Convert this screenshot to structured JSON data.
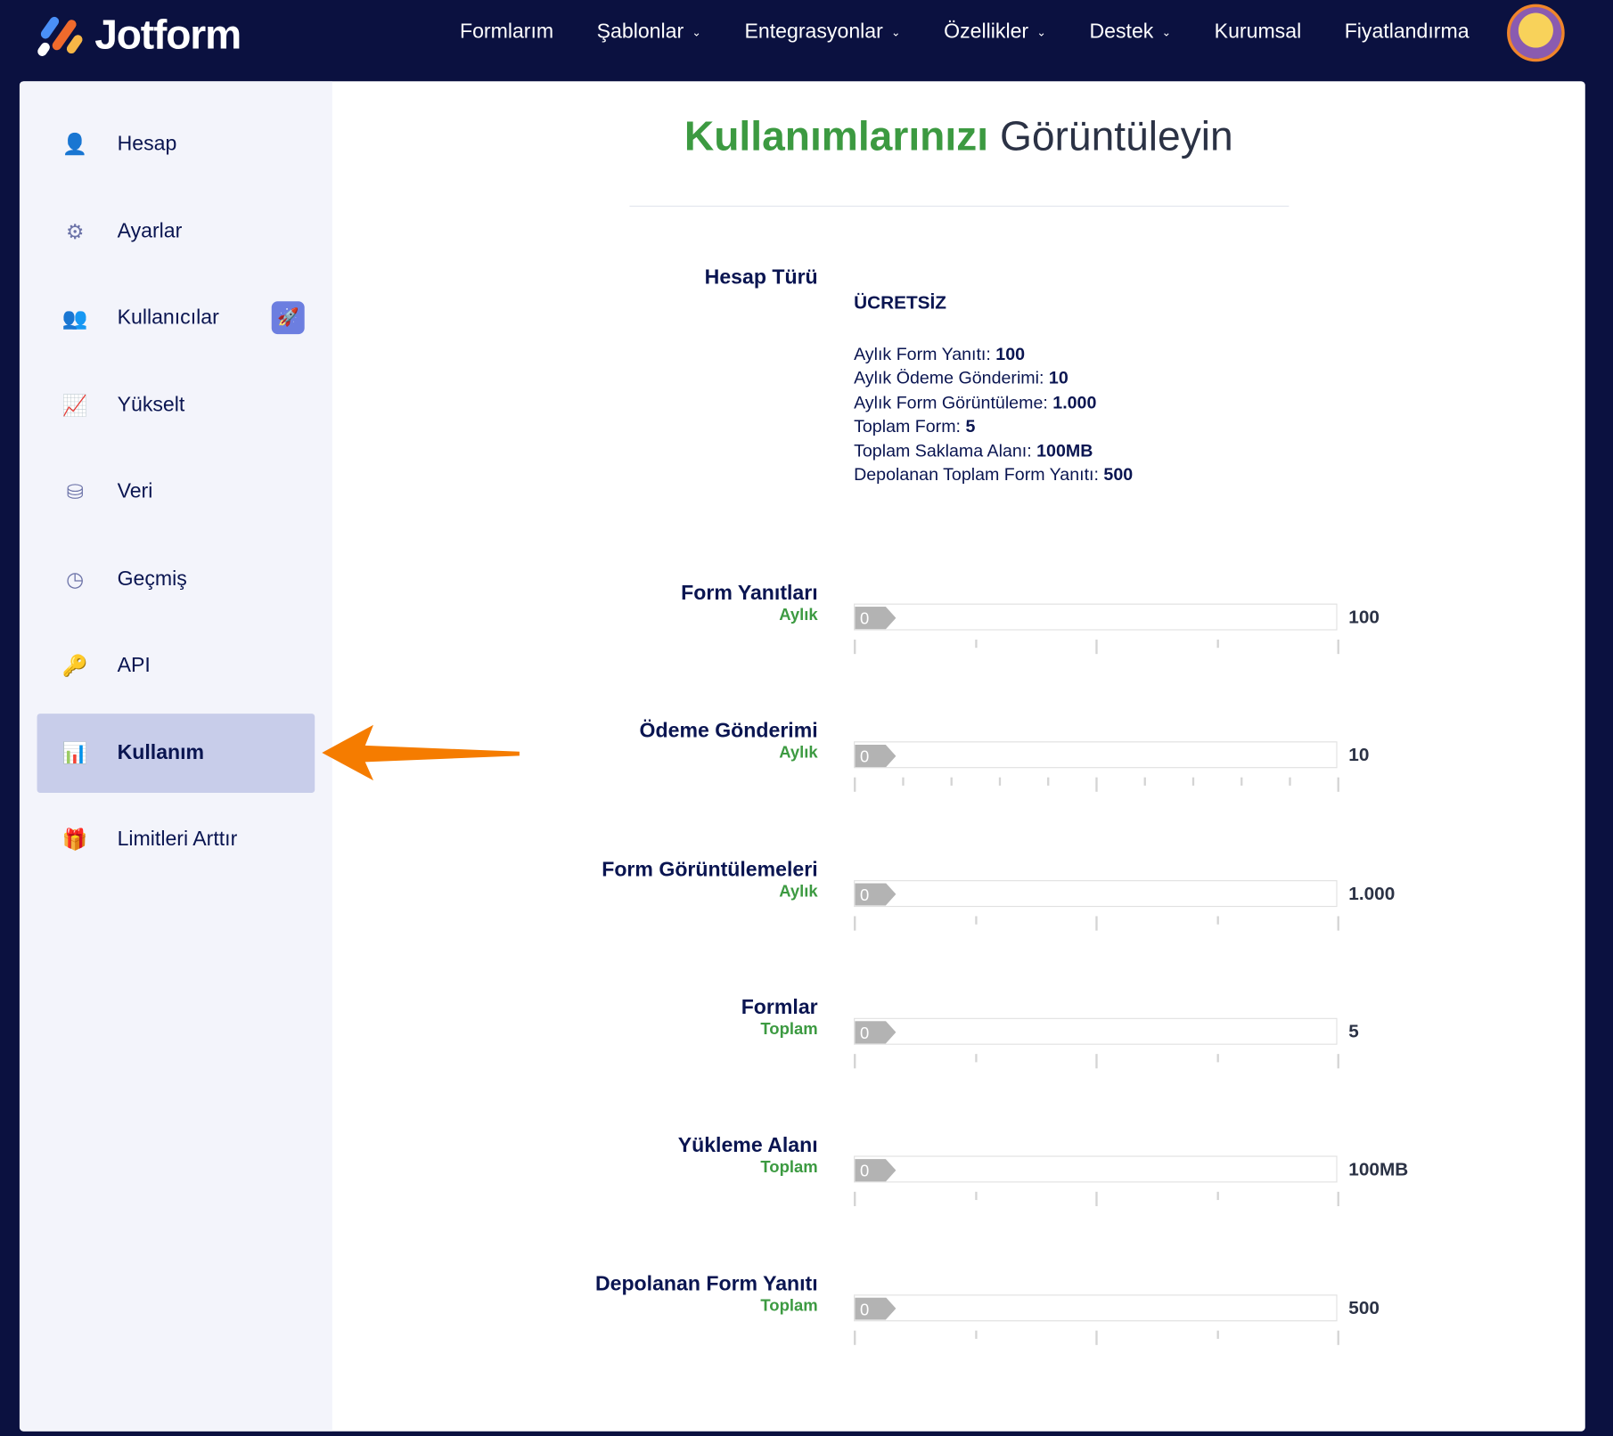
{
  "brand": {
    "name": "Jotform"
  },
  "nav": {
    "items": [
      {
        "label": "Formlarım",
        "dropdown": false
      },
      {
        "label": "Şablonlar",
        "dropdown": true
      },
      {
        "label": "Entegrasyonlar",
        "dropdown": true
      },
      {
        "label": "Özellikler",
        "dropdown": true
      },
      {
        "label": "Destek",
        "dropdown": true
      },
      {
        "label": "Kurumsal",
        "dropdown": false
      },
      {
        "label": "Fiyatlandırma",
        "dropdown": false
      }
    ]
  },
  "sidebar": {
    "items": [
      {
        "label": "Hesap",
        "icon": "user-icon"
      },
      {
        "label": "Ayarlar",
        "icon": "gear-icon"
      },
      {
        "label": "Kullanıcılar",
        "icon": "users-icon"
      },
      {
        "label": "Yükselt",
        "icon": "upgrade-chart-icon"
      },
      {
        "label": "Veri",
        "icon": "database-icon"
      },
      {
        "label": "Geçmiş",
        "icon": "history-icon"
      },
      {
        "label": "API",
        "icon": "key-icon"
      },
      {
        "label": "Kullanım",
        "icon": "bar-chart-icon",
        "active": true
      },
      {
        "label": "Limitleri Arttır",
        "icon": "gift-icon"
      }
    ]
  },
  "page": {
    "title_highlight": "Kullanımlarınızı",
    "title_rest": "Görüntüleyin"
  },
  "account": {
    "label": "Hesap Türü",
    "plan": "ÜCRETSİZ",
    "limits": [
      {
        "k": "Aylık Form Yanıtı:",
        "v": "100"
      },
      {
        "k": "Aylık Ödeme Gönderimi:",
        "v": "10"
      },
      {
        "k": "Aylık Form Görüntüleme:",
        "v": "1.000"
      },
      {
        "k": "Toplam Form:",
        "v": "5"
      },
      {
        "k": "Toplam Saklama Alanı:",
        "v": "100MB"
      },
      {
        "k": "Depolanan Toplam Form Yanıtı:",
        "v": "500"
      }
    ]
  },
  "usage": [
    {
      "label": "Form Yanıtları",
      "period": "Aylık",
      "used": "0",
      "max": "100",
      "minor": 4
    },
    {
      "label": "Ödeme Gönderimi",
      "period": "Aylık",
      "used": "0",
      "max": "10",
      "minor": 10
    },
    {
      "label": "Form Görüntülemeleri",
      "period": "Aylık",
      "used": "0",
      "max": "1.000",
      "minor": 4
    },
    {
      "label": "Formlar",
      "period": "Toplam",
      "used": "0",
      "max": "5",
      "minor": 4
    },
    {
      "label": "Yükleme Alanı",
      "period": "Toplam",
      "used": "0",
      "max": "100MB",
      "minor": 4
    },
    {
      "label": "Depolanan Form Yanıtı",
      "period": "Toplam",
      "used": "0",
      "max": "500",
      "minor": 4
    }
  ],
  "colors": {
    "nav": "#0b1140",
    "accent": "#3c9a41",
    "active": "#c8cdea",
    "arrow": "#f57c00"
  }
}
